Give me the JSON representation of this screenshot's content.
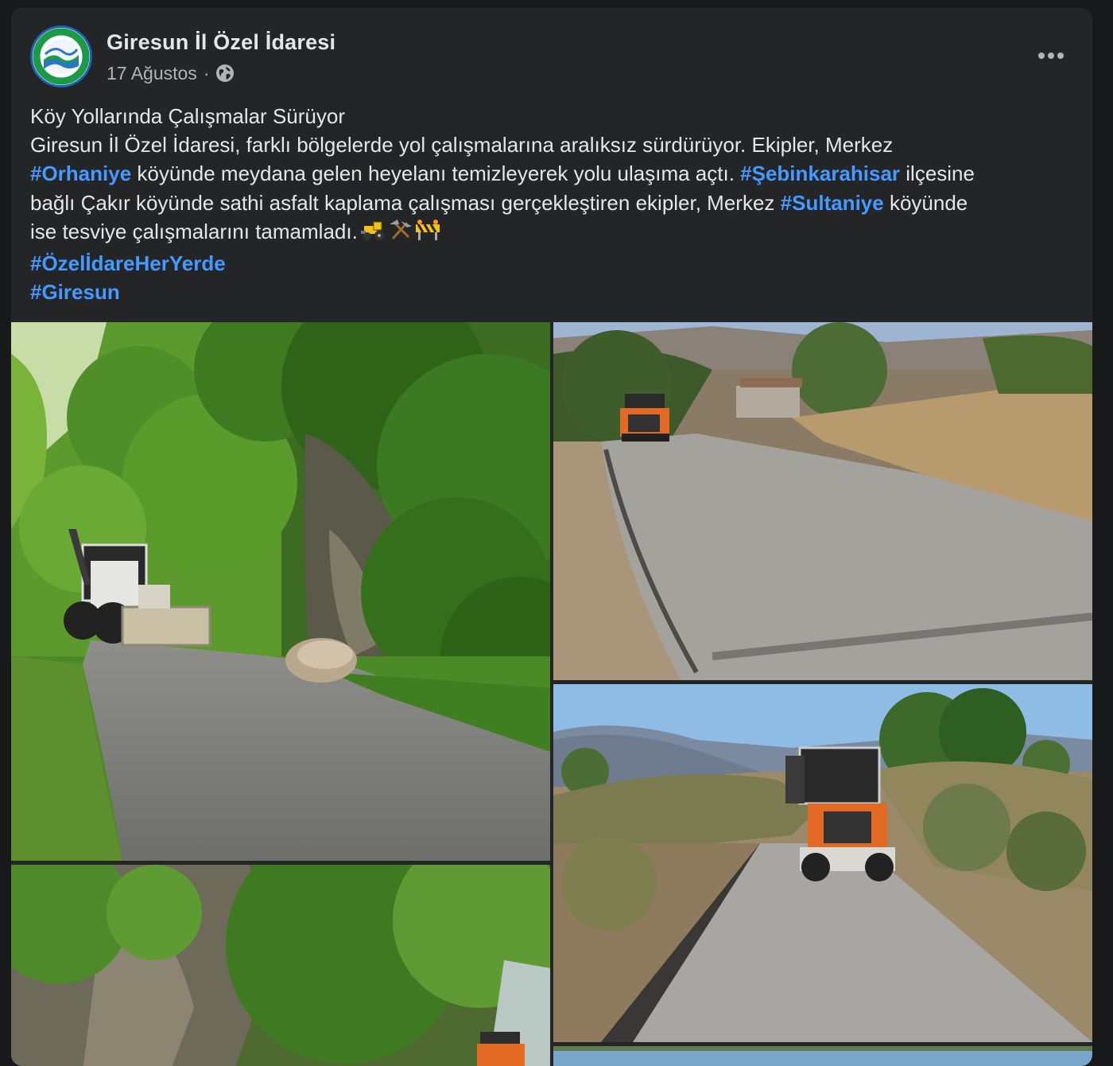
{
  "post": {
    "author": "Giresun İl Özel İdaresi",
    "date": "17 Ağustos",
    "separator": "·",
    "audience_icon": "globe-icon",
    "more_icon": "more-dots-icon",
    "logo_text": "GİRESUN İL ÖZEL İDARESİ",
    "text": {
      "line1": "Köy Yollarında Çalışmalar Sürüyor",
      "line2": "Giresun İl Özel İdaresi, farklı bölgelerde yol çalışmalarına aralıksız sürdürüyor. Ekipler, Merkez",
      "tag_orhaniye": "#Orhaniye",
      "line3_mid": " köyünde meydana gelen heyelanı temizleyerek yolu ulaşıma açtı. ",
      "tag_sebinkarahisar": "#Şebinkarahisar",
      "line3_end": " ilçesine",
      "line4_start": "bağlı Çakır köyünde sathi asfalt kaplama çalışması gerçekleştiren ekipler, Merkez ",
      "tag_sultaniye": "#Sultaniye",
      "line4_end": " köyünde",
      "line5": "ise tesviye çalışmalarını tamamladı.",
      "emojis": [
        "tractor-emoji",
        "hammer-pick-emoji",
        "construction-barrier-emoji"
      ],
      "tag_ozelidare": "#ÖzelİdareHerYerde",
      "tag_giresun": "#Giresun"
    },
    "photos": [
      {
        "name": "photo-backhoe-forest-road",
        "subject": "backhoe loader clearing landslide on forest road"
      },
      {
        "name": "photo-asphalt-road-orange-roller",
        "subject": "orange roller on newly paved village road"
      },
      {
        "name": "photo-orange-roller-hill-road",
        "subject": "orange roller approaching on gravel road with hills"
      },
      {
        "name": "photo-rock-wall-forest",
        "subject": "rock wall with foliage and machine"
      },
      {
        "name": "photo-partial-bottom",
        "subject": "partially visible photo"
      }
    ],
    "colors": {
      "background": "#18191a",
      "card": "#242526",
      "text": "#e4e6eb",
      "secondary_text": "#b0b3b8",
      "hashtag": "#4599ff"
    }
  }
}
